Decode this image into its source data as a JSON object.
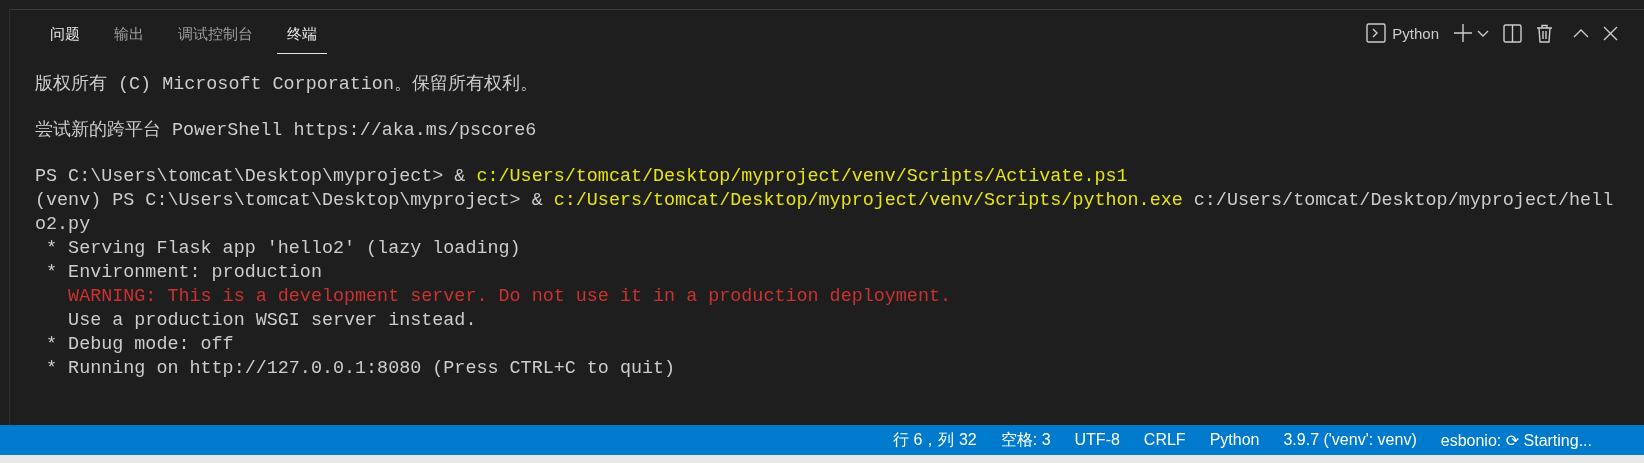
{
  "panel": {
    "tabs": [
      {
        "label": "问题",
        "selected": false
      },
      {
        "label": "输出",
        "selected": false
      },
      {
        "label": "调试控制台",
        "selected": false
      },
      {
        "label": "终端",
        "selected": true
      }
    ],
    "terminal_profile": "Python"
  },
  "terminal": {
    "lines": [
      {
        "kind": "text",
        "segments": [
          {
            "text": "版权所有 (C) Microsoft Corporation。保留所有权利。",
            "kind": "plain"
          }
        ]
      },
      {
        "kind": "blank"
      },
      {
        "kind": "text",
        "segments": [
          {
            "text": "尝试新的跨平台 PowerShell https://aka.ms/pscore6",
            "kind": "plain"
          }
        ]
      },
      {
        "kind": "blank"
      },
      {
        "kind": "text",
        "segments": [
          {
            "text": "PS C:\\Users\\tomcat\\Desktop\\myproject> & ",
            "kind": "plain"
          },
          {
            "text": "c:/Users/tomcat/Desktop/myproject/venv/Scripts/Activate.ps1",
            "kind": "command"
          }
        ]
      },
      {
        "kind": "text",
        "segments": [
          {
            "text": "(venv) PS C:\\Users\\tomcat\\Desktop\\myproject> & ",
            "kind": "plain"
          },
          {
            "text": "c:/Users/tomcat/Desktop/myproject/venv/Scripts/python.exe",
            "kind": "command"
          },
          {
            "text": " c:/Users/tomcat/Desktop/myproject/hell",
            "kind": "plain"
          }
        ]
      },
      {
        "kind": "text",
        "segments": [
          {
            "text": "o2.py",
            "kind": "plain"
          }
        ]
      },
      {
        "kind": "text",
        "segments": [
          {
            "text": " * Serving Flask app 'hello2' (lazy loading)",
            "kind": "plain"
          }
        ]
      },
      {
        "kind": "text",
        "segments": [
          {
            "text": " * Environment: production",
            "kind": "plain"
          }
        ]
      },
      {
        "kind": "text",
        "segments": [
          {
            "text": "   WARNING: This is a development server. Do not use it in a production deployment.",
            "kind": "warning"
          }
        ]
      },
      {
        "kind": "text",
        "segments": [
          {
            "text": "   Use a production WSGI server instead.",
            "kind": "plain"
          }
        ]
      },
      {
        "kind": "text",
        "segments": [
          {
            "text": " * Debug mode: off",
            "kind": "plain"
          }
        ]
      },
      {
        "kind": "text",
        "segments": [
          {
            "text": " * Running on http://127.0.0.1:8080 (Press CTRL+C to quit)",
            "kind": "plain"
          }
        ]
      }
    ]
  },
  "status_bar": {
    "items": [
      "行 6，列 32",
      "空格: 3",
      "UTF-8",
      "CRLF",
      "Python",
      "3.9.7 ('venv': venv)",
      "esbonio: ⟳ Starting..."
    ]
  }
}
